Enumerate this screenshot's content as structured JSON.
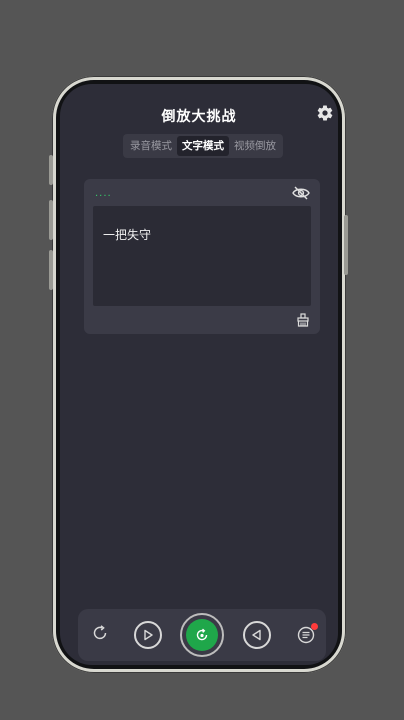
{
  "app": {
    "title": "倒放大挑战",
    "settings_icon": "gear-icon"
  },
  "tabs": [
    {
      "label": "录音模式",
      "active": false
    },
    {
      "label": "文字模式",
      "active": true
    },
    {
      "label": "视频倒放",
      "active": false
    }
  ],
  "text_card": {
    "indicator": "....",
    "content": "一把失守",
    "hide_icon": "eye-off-icon",
    "clear_icon": "eraser-icon"
  },
  "bottom_bar": {
    "items": [
      {
        "name": "replay",
        "icon": "refresh-icon"
      },
      {
        "name": "play",
        "icon": "play-icon"
      },
      {
        "name": "record",
        "icon": "record-icon"
      },
      {
        "name": "reverse-play",
        "icon": "reverse-play-icon"
      },
      {
        "name": "list",
        "icon": "list-icon",
        "has_badge": true
      }
    ]
  },
  "colors": {
    "background": "#555555",
    "screen": "#2d2d38",
    "accent_green": "#1fa74a",
    "badge_red": "#ff3b3b"
  }
}
